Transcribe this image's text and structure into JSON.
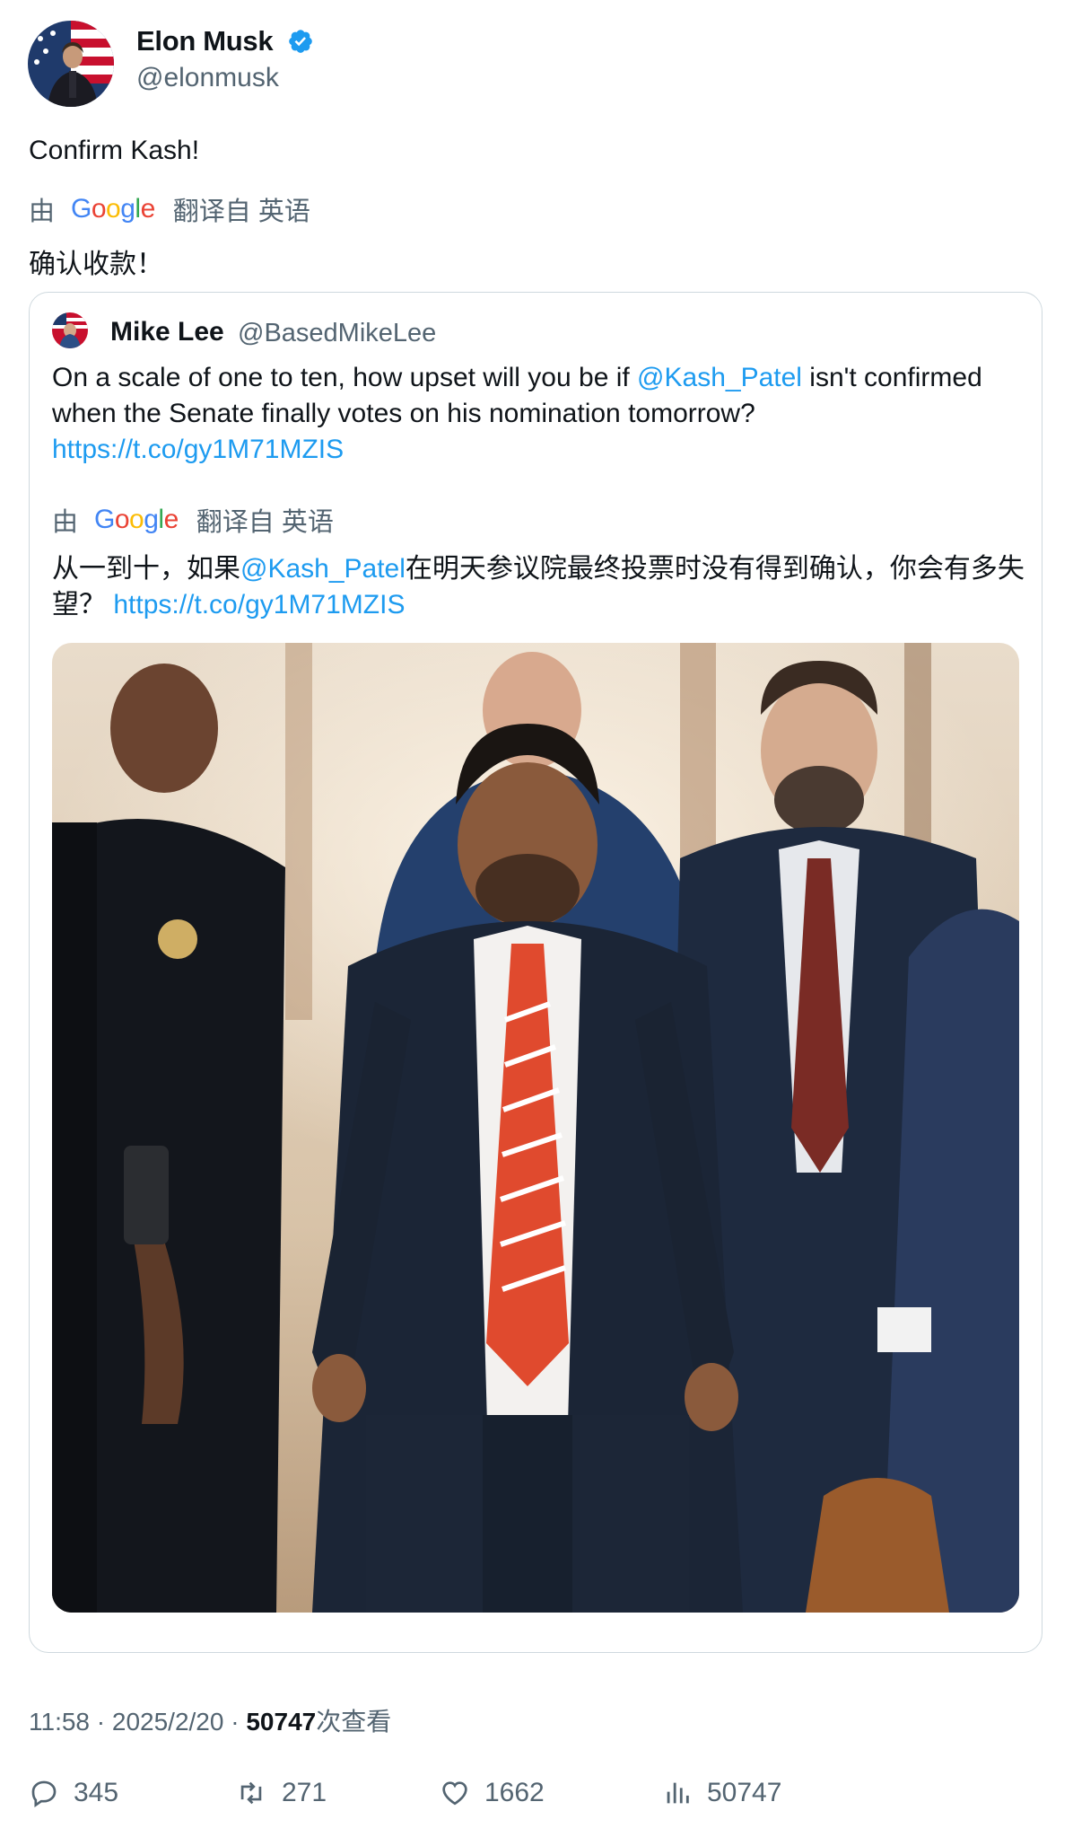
{
  "author": {
    "name": "Elon Musk",
    "handle": "@elonmusk"
  },
  "tweet": {
    "text": "Confirm Kash!",
    "translation_prefix": "由",
    "translation_suffix": "翻译自 英语",
    "translated_text": "确认收款！"
  },
  "quote": {
    "name": "Mike Lee",
    "handle": "@BasedMikeLee",
    "text_before_mention": "On a scale of one to ten, how upset will you be if ",
    "mention": "@Kash_Patel",
    "text_after_mention": " isn't confirmed when the Senate finally votes on his nomination tomorrow?",
    "link": "https://t.co/gy1M71MZIS",
    "translation_prefix": "由",
    "translation_suffix": "翻译自 英语",
    "translated_before": "从一到十，如果",
    "translated_mention": "@Kash_Patel",
    "translated_after": "在明天参议院最终投票时没有得到确认，你会有多失望？",
    "translated_link": "https://t.co/gy1M71MZIS"
  },
  "meta": {
    "time": "11:58",
    "separator": "·",
    "date": "2025/2/20",
    "views": "50747",
    "views_label": "次查看"
  },
  "actions": {
    "replies": "345",
    "retweets": "271",
    "likes": "1662",
    "views": "50747"
  },
  "colors": {
    "link": "#1d9bf0",
    "muted": "#536471",
    "border": "#cfd9de",
    "verified": "#1d9bf0"
  }
}
